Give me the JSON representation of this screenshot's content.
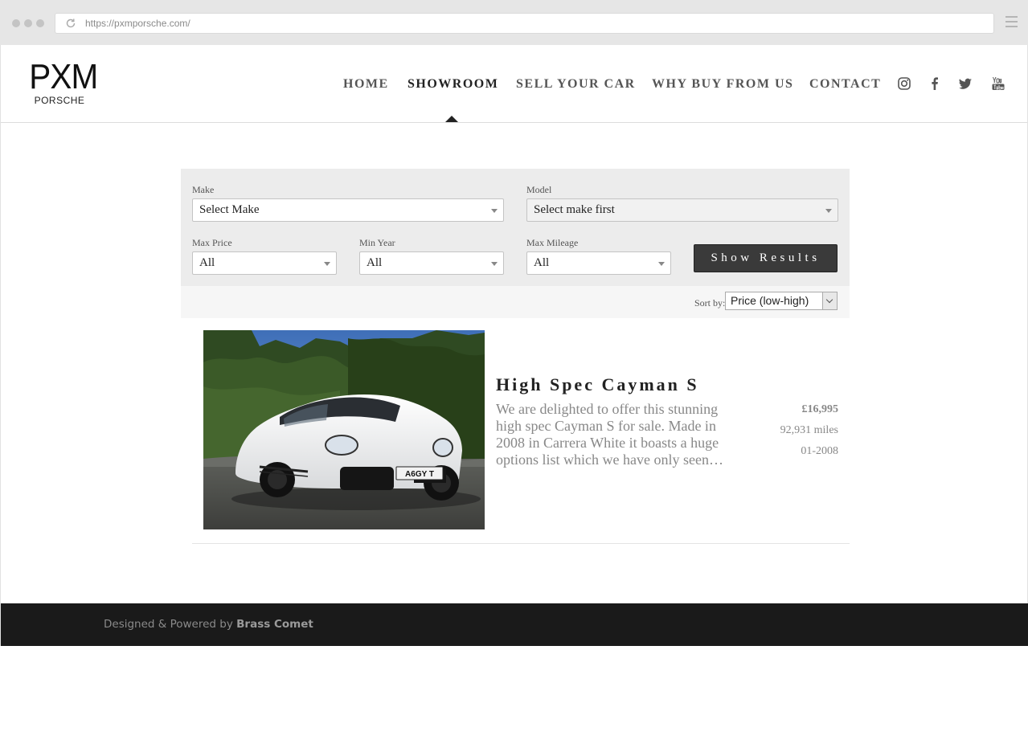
{
  "browser": {
    "url": "https://pxmporsche.com/"
  },
  "logo": {
    "main": "PXM",
    "sub": "PORSCHE"
  },
  "nav": {
    "items": [
      {
        "label": "HOME"
      },
      {
        "label": "SHOWROOM",
        "active": true
      },
      {
        "label": "SELL YOUR CAR"
      },
      {
        "label": "WHY BUY FROM US"
      },
      {
        "label": "CONTACT"
      }
    ],
    "social": [
      "instagram-icon",
      "facebook-icon",
      "twitter-icon",
      "youtube-icon"
    ]
  },
  "search": {
    "make": {
      "label": "Make",
      "value": "Select Make"
    },
    "model": {
      "label": "Model",
      "value": "Select make first"
    },
    "max_price": {
      "label": "Max Price",
      "value": "All"
    },
    "min_year": {
      "label": "Min Year",
      "value": "All"
    },
    "max_mileage": {
      "label": "Max Mileage",
      "value": "All"
    },
    "button_label": "Show Results"
  },
  "sort": {
    "label": "Sort by:",
    "value": "Price (low-high)"
  },
  "listing": {
    "title": "High Spec Cayman S",
    "description": "We are delighted to offer this stunning high spec Cayman S for sale. Made in 2008 in Carrera White it boasts a huge options list which we have only seen…",
    "price": "£16,995",
    "mileage": "92,931 miles",
    "date": "01-2008",
    "plate": "A6GY T"
  },
  "footer": {
    "prefix": "Designed & Powered by ",
    "brand": "Brass Comet"
  },
  "colors": {
    "chrome": "#e6e6e6",
    "button": "#3a3a3a",
    "footer": "#1a1a1a",
    "panel": "#ececec"
  }
}
